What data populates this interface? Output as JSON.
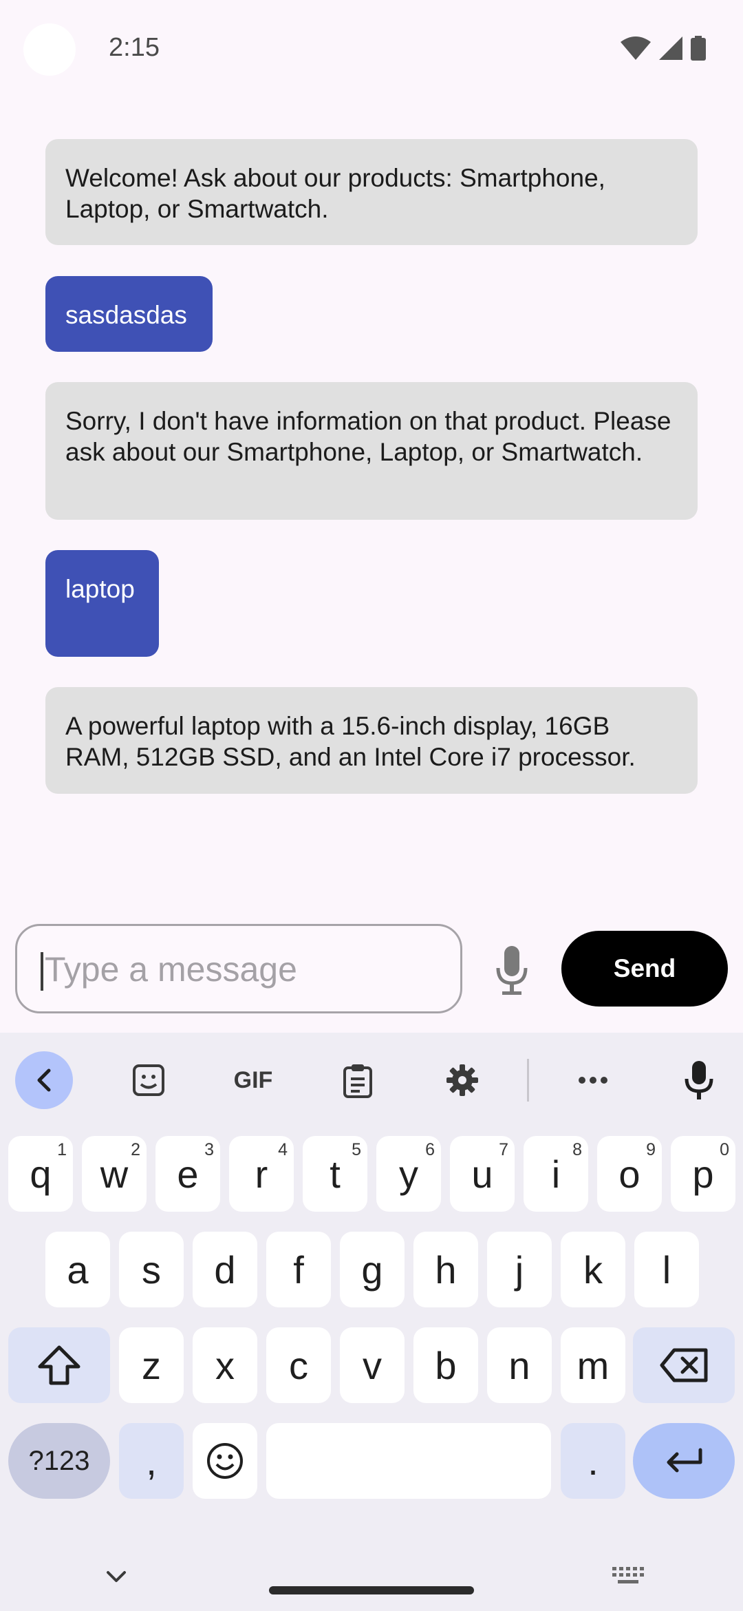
{
  "status_bar": {
    "time": "2:15"
  },
  "chat": {
    "messages": [
      {
        "sender": "bot",
        "text": "Welcome! Ask about our products: Smartphone, Laptop, or Smartwatch."
      },
      {
        "sender": "user",
        "text": "sasdasdas"
      },
      {
        "sender": "bot",
        "text": "Sorry, I don't have information on that product. Please ask about our Smartphone, Laptop, or Smartwatch."
      },
      {
        "sender": "user",
        "text": "laptop"
      },
      {
        "sender": "bot",
        "text": "A powerful laptop with a 15.6-inch display, 16GB RAM, 512GB SSD, and an Intel Core i7 processor."
      }
    ]
  },
  "input": {
    "placeholder": "Type a message",
    "value": ""
  },
  "send_label": "Send",
  "keyboard": {
    "toolbar": [
      "chevron-left-icon",
      "sticker-icon",
      "gif-icon",
      "clipboard-icon",
      "gear-icon",
      "more-icon",
      "microphone-icon"
    ],
    "gif_label": "GIF",
    "row1": [
      {
        "k": "q",
        "h": "1"
      },
      {
        "k": "w",
        "h": "2"
      },
      {
        "k": "e",
        "h": "3"
      },
      {
        "k": "r",
        "h": "4"
      },
      {
        "k": "t",
        "h": "5"
      },
      {
        "k": "y",
        "h": "6"
      },
      {
        "k": "u",
        "h": "7"
      },
      {
        "k": "i",
        "h": "8"
      },
      {
        "k": "o",
        "h": "9"
      },
      {
        "k": "p",
        "h": "0"
      }
    ],
    "row2": [
      "a",
      "s",
      "d",
      "f",
      "g",
      "h",
      "j",
      "k",
      "l"
    ],
    "row3": [
      "z",
      "x",
      "c",
      "v",
      "b",
      "n",
      "m"
    ],
    "sym_label": "?123",
    "comma_label": ",",
    "period_label": "."
  },
  "colors": {
    "user_bubble": "#3f51b5",
    "bot_bubble": "#e0e0e0",
    "send_button": "#000000",
    "accent": "#b3c4fb"
  }
}
